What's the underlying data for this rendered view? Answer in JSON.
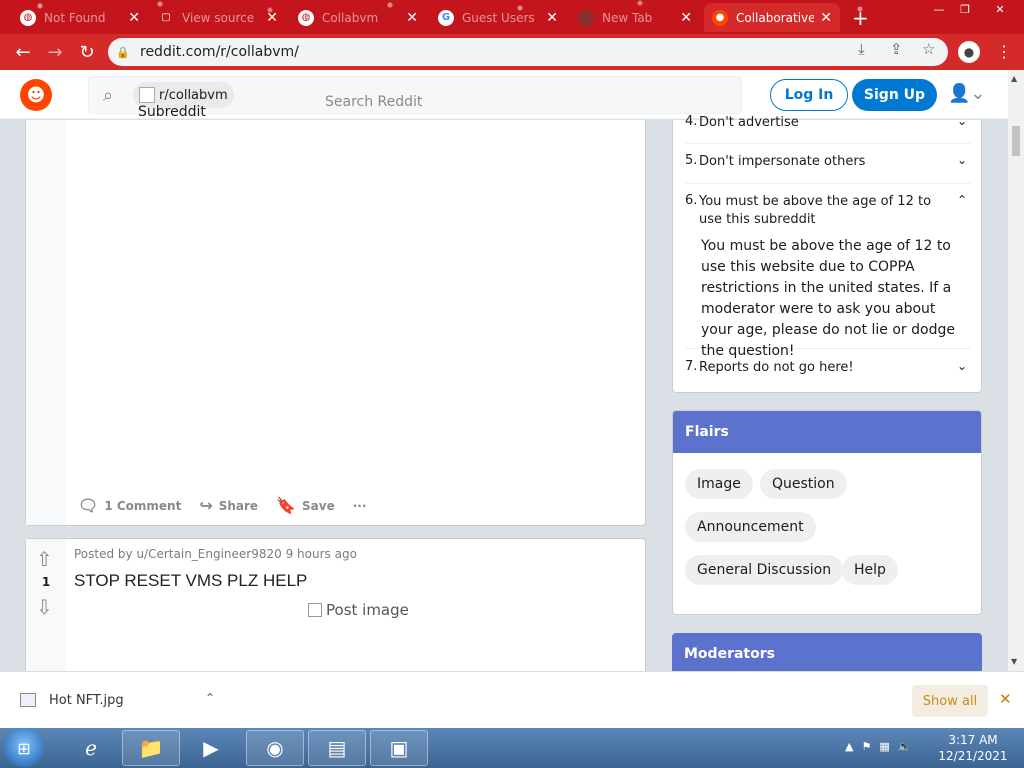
{
  "browser": {
    "tabs": [
      {
        "title": "Not Found",
        "active": false
      },
      {
        "title": "View source",
        "active": false
      },
      {
        "title": "Collabvm",
        "active": false
      },
      {
        "title": "Guest Users",
        "active": false
      },
      {
        "title": "New Tab",
        "active": false
      },
      {
        "title": "Collaborative",
        "active": true
      }
    ],
    "url": "reddit.com/r/collabvm/"
  },
  "header": {
    "community_chip": "r/collabvm",
    "chip_image_alt": "Subreddit Icon",
    "search_placeholder": "Search Reddit",
    "login_label": "Log In",
    "signup_label": "Sign Up"
  },
  "post1": {
    "comments_label": "1 Comment",
    "share_label": "Share",
    "save_label": "Save",
    "more_label": "···"
  },
  "post2": {
    "meta": "Posted by u/Certain_Engineer9820 9 hours ago",
    "votes": "1",
    "title": "STOP RESET VMS PLZ HELP",
    "image_alt": "Post image"
  },
  "rules": [
    {
      "num": "4.",
      "text": "Don't advertise",
      "expanded": false
    },
    {
      "num": "5.",
      "text": "Don't impersonate others",
      "expanded": false
    },
    {
      "num": "6.",
      "text": "You must be above the age of 12 to use this subreddit",
      "expanded": true
    },
    {
      "num": "7.",
      "text": "Reports do not go here!",
      "expanded": false
    }
  ],
  "rule6_description": "You must be above the age of 12 to use this website due to COPPA restrictions in the united states. If a moderator were to ask you about your age, please do not lie or dodge the question!",
  "flairs": {
    "heading": "Flairs",
    "items": [
      "Image",
      "Question",
      "Announcement",
      "General Discussion",
      "Help"
    ]
  },
  "moderators": {
    "heading": "Moderators"
  },
  "downloads": {
    "file": "Hot NFT.jpg",
    "show_all": "Show all"
  },
  "taskbar": {
    "time": "3:17 AM",
    "date": "12/21/2021"
  },
  "colors": {
    "reddit_blue": "#0079d3",
    "card_header": "#5b73cc",
    "browser_theme": "#c4141c"
  }
}
